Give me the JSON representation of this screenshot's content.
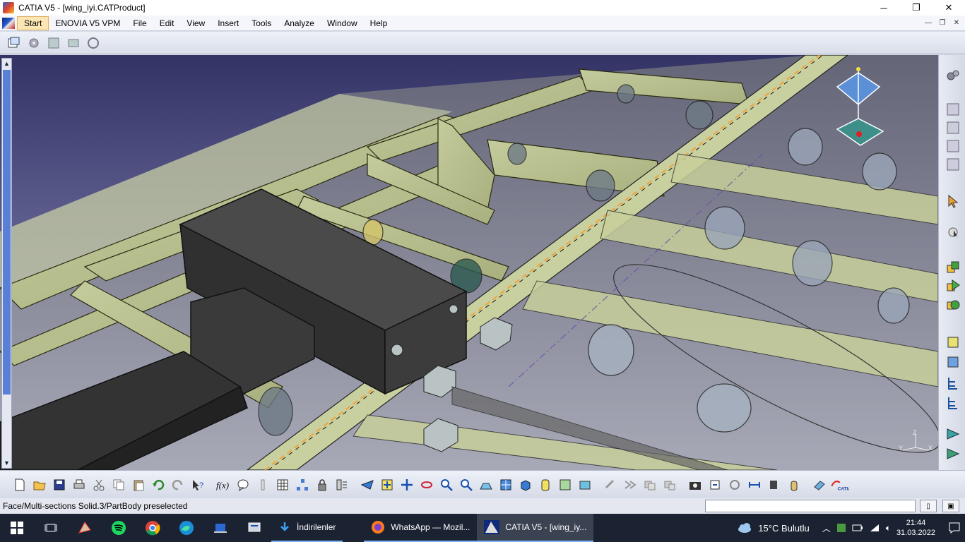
{
  "window": {
    "title": "CATIA V5 - [wing_iyi.CATProduct]",
    "minimize": "─",
    "maximize": "❐",
    "close": "✕"
  },
  "menubar": {
    "items": [
      "Start",
      "ENOVIA V5 VPM",
      "File",
      "Edit",
      "View",
      "Insert",
      "Tools",
      "Analyze",
      "Window",
      "Help"
    ],
    "mdi_minimize": "—",
    "mdi_restore": "❐",
    "mdi_close": "✕"
  },
  "status": {
    "message": "Face/Multi-sections Solid.3/PartBody preselected"
  },
  "taskbar": {
    "apps": [
      {
        "label": "İndirilenler"
      },
      {
        "label": "WhatsApp — Mozil..."
      },
      {
        "label": "CATIA V5 - [wing_iy..."
      }
    ],
    "weather": "15°C  Bulutlu",
    "time": "21:44",
    "date": "31.03.2022"
  },
  "compass_axes": {
    "x": "X",
    "y": "Y",
    "z": "Z"
  },
  "colors": {
    "viewport_bg": "#3a3a6e",
    "part_color": "#c8cf9a",
    "box_color": "#3d3d3d",
    "accent": "#f2a33a"
  }
}
